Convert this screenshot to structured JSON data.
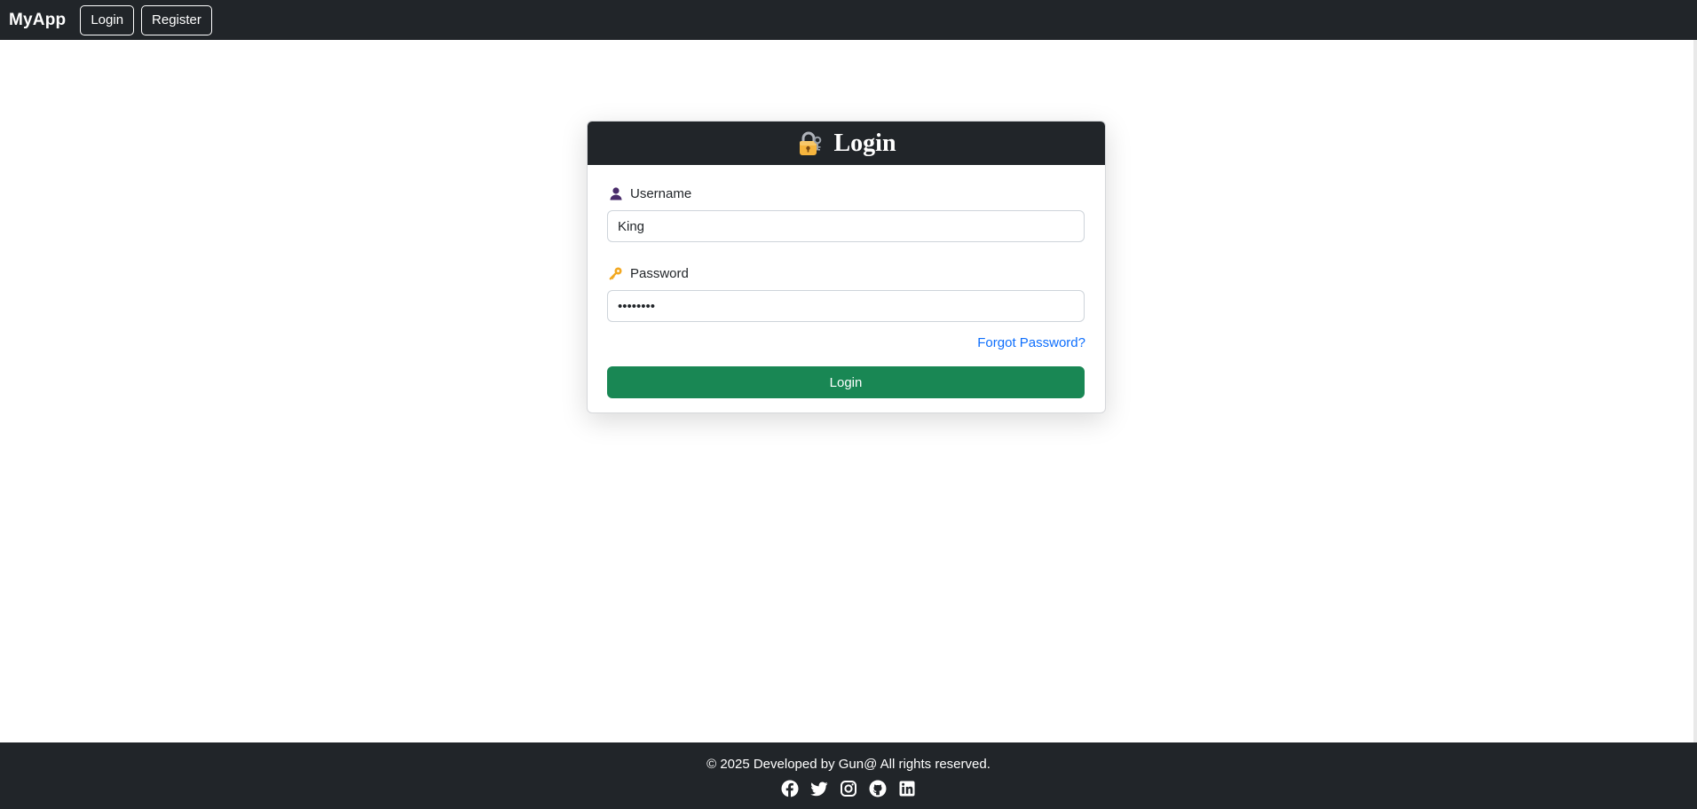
{
  "navbar": {
    "brand": "MyApp",
    "login_label": "Login",
    "register_label": "Register"
  },
  "login_card": {
    "title": "Login",
    "title_icon": "lock-with-key-icon",
    "username": {
      "label": "Username",
      "icon": "user-icon",
      "value": "King"
    },
    "password": {
      "label": "Password",
      "icon": "key-icon",
      "value": "••••••••"
    },
    "forgot_password": "Forgot Password?",
    "submit_label": "Login"
  },
  "footer": {
    "text": "© 2025 Developed by Gun@ All rights reserved.",
    "social_icons": [
      "facebook-icon",
      "twitter-icon",
      "instagram-icon",
      "github-icon",
      "linkedin-icon"
    ]
  },
  "colors": {
    "navbar_bg": "#212529",
    "submit_bg": "#198754",
    "link": "#0d6efd"
  }
}
